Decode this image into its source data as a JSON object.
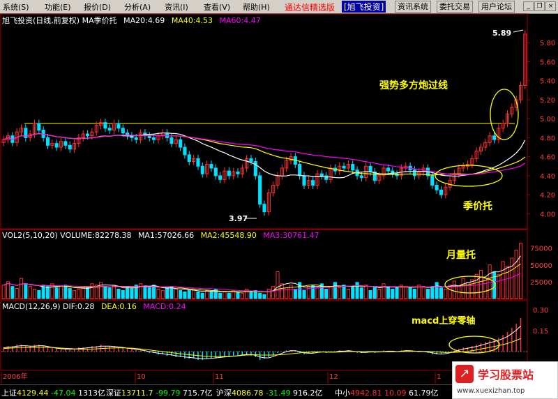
{
  "menu": {
    "items": [
      "系统(S)",
      "功能(E)",
      "报价(D)",
      "分析(A)",
      "资讯(I)",
      "查看(V)",
      "帮助(H)"
    ],
    "brand": "通达信精选版",
    "stock_tag": "[旭飞投资]",
    "buttons": [
      "资讯系统",
      "委托交易",
      "用户论坛"
    ]
  },
  "price_header": {
    "title": "旭飞投资(日线,前复权) MA季价托",
    "ma20": "MA20:4.69",
    "ma40": "MA40:4.53",
    "ma60": "MA60:4.47"
  },
  "vol_header": {
    "title": "VOL2(5,10,20) VOLUME:82278.38",
    "ma1": "MA1:57026.66",
    "ma2": "MA2:45548.90",
    "ma3": "MA3:30761.47"
  },
  "macd_header": {
    "title": "MACD(12,26,9) DIF:0.28",
    "dea": "DEA:0.16",
    "macd": "MACD:0.24"
  },
  "annotations": {
    "strong": "强势多方炮过线",
    "season": "季价托",
    "month": "月量托",
    "macd": "macd上穿零轴",
    "high": "5.89",
    "low": "3.97"
  },
  "axis": {
    "price_ticks": [
      "5.80",
      "5.60",
      "5.40",
      "5.20",
      "5.00",
      "4.80",
      "4.60",
      "4.40",
      "4.20",
      "4.00"
    ],
    "vol_ticks": [
      "75000",
      "50000",
      "25000"
    ],
    "macd_ticks": [
      "0.30",
      "0.15"
    ],
    "date_ticks": [
      "2006年",
      "10",
      "11",
      "12",
      "1"
    ]
  },
  "status": {
    "sh_label": "上证",
    "sh_val": "4129.44",
    "sh_chg": "-47.04",
    "sh_amt": "1313亿",
    "sz_label": "深证",
    "sz_val": "13711.7",
    "sz_chg": "-99.79",
    "sz_amt": "715.7亿",
    "hs_label": "沪深",
    "hs_val": "4086.78",
    "hs_chg": "-31.49",
    "hs_amt": "916.2亿",
    "zx_label": "中小",
    "zx_val": "4942.81",
    "zx_chg": "10.09",
    "zx_amt": "61.79亿"
  },
  "watermark": {
    "name": "学习股票站",
    "url": "www.xuexizhan.top"
  },
  "colors": {
    "up": "#ff3030",
    "down": "#00e0ff",
    "ma20": "#ffffff",
    "ma40": "#ffff00",
    "ma60": "#ff00ff",
    "reference": "#ffff00"
  },
  "chart_data": {
    "type": "candlestick",
    "reference_line": 4.95,
    "ylim": [
      3.9,
      6.0
    ],
    "highest": 5.89,
    "lowest": 3.97,
    "closes": [
      4.78,
      4.82,
      4.75,
      4.86,
      4.9,
      4.8,
      4.84,
      4.95,
      4.88,
      4.8,
      4.72,
      4.74,
      4.7,
      4.76,
      4.72,
      4.68,
      4.74,
      4.8,
      4.84,
      4.82,
      4.86,
      4.93,
      4.96,
      4.9,
      4.88,
      4.95,
      4.9,
      4.85,
      4.82,
      4.8,
      4.78,
      4.85,
      4.82,
      4.8,
      4.78,
      4.82,
      4.85,
      4.8,
      4.74,
      4.78,
      4.7,
      4.62,
      4.55,
      4.58,
      4.5,
      4.42,
      4.52,
      4.48,
      4.4,
      4.36,
      4.45,
      4.4,
      4.44,
      4.42,
      4.48,
      4.58,
      4.55,
      4.4,
      4.1,
      4.02,
      4.22,
      4.3,
      4.4,
      4.48,
      4.56,
      4.6,
      4.52,
      4.4,
      4.3,
      4.35,
      4.3,
      4.42,
      4.4,
      4.36,
      4.48,
      4.45,
      4.5,
      4.48,
      4.52,
      4.46,
      4.4,
      4.38,
      4.5,
      4.44,
      4.35,
      4.4,
      4.48,
      4.45,
      4.42,
      4.4,
      4.48,
      4.5,
      4.46,
      4.4,
      4.44,
      4.48,
      4.4,
      4.3,
      4.25,
      4.2,
      4.28,
      4.35,
      4.42,
      4.48,
      4.5,
      4.52,
      4.58,
      4.66,
      4.7,
      4.75,
      4.82,
      4.78,
      4.9,
      4.95,
      5.05,
      5.12,
      5.2,
      5.35,
      5.89
    ],
    "volume": [
      20000,
      25000,
      18000,
      15000,
      30000,
      22000,
      18000,
      14000,
      12000,
      20000,
      18000,
      22000,
      16000,
      18000,
      20000,
      15000,
      12000,
      14000,
      16000,
      18000,
      22000,
      20000,
      24000,
      18000,
      16000,
      20000,
      14000,
      12000,
      18000,
      16000,
      20000,
      22000,
      18000,
      16000,
      20000,
      14000,
      12000,
      16000,
      18000,
      14000,
      12000,
      10000,
      12000,
      14000,
      10000,
      8000,
      12000,
      10000,
      14000,
      8000,
      10000,
      8000,
      12000,
      10000,
      8000,
      14000,
      10000,
      12000,
      8000,
      6000,
      14000,
      18000,
      40000,
      22000,
      16000,
      20000,
      14000,
      24000,
      12000,
      18000,
      20000,
      16000,
      22000,
      14000,
      18000,
      24000,
      16000,
      20000,
      14000,
      18000,
      24000,
      16000,
      20000,
      12000,
      18000,
      14000,
      22000,
      18000,
      14000,
      16000,
      20000,
      18000,
      16000,
      14000,
      20000,
      18000,
      14000,
      18000,
      24000,
      16000,
      14000,
      20000,
      26000,
      18000,
      30000,
      24000,
      28000,
      36000,
      42000,
      30000,
      50000,
      40000,
      36000,
      55000,
      48000,
      60000,
      72000,
      82278
    ],
    "macd": [
      0.03,
      0.04,
      0.04,
      0.05,
      0.05,
      0.04,
      0.04,
      0.05,
      0.05,
      0.04,
      0.03,
      0.03,
      0.02,
      0.02,
      0.02,
      0.02,
      0.02,
      0.03,
      0.03,
      0.03,
      0.04,
      0.04,
      0.05,
      0.04,
      0.04,
      0.04,
      0.03,
      0.03,
      0.02,
      0.02,
      0.01,
      0.01,
      0.0,
      -0.01,
      -0.01,
      -0.02,
      -0.02,
      -0.03,
      -0.03,
      -0.04,
      -0.04,
      -0.05,
      -0.05,
      -0.05,
      -0.06,
      -0.06,
      -0.05,
      -0.05,
      -0.05,
      -0.04,
      -0.04,
      -0.04,
      -0.03,
      -0.03,
      -0.02,
      -0.02,
      -0.03,
      -0.04,
      -0.06,
      -0.05,
      -0.04,
      -0.03,
      -0.01,
      0.0,
      0.01,
      0.01,
      0.0,
      -0.01,
      -0.02,
      -0.01,
      -0.01,
      0.0,
      0.0,
      -0.01,
      0.0,
      0.0,
      0.01,
      0.0,
      0.01,
      0.0,
      -0.01,
      -0.01,
      0.0,
      0.0,
      -0.01,
      0.0,
      0.01,
      0.0,
      0.0,
      0.0,
      0.01,
      0.01,
      0.0,
      0.0,
      0.0,
      0.0,
      -0.01,
      -0.02,
      -0.02,
      -0.02,
      -0.01,
      0.0,
      0.01,
      0.02,
      0.03,
      0.03,
      0.04,
      0.05,
      0.06,
      0.07,
      0.08,
      0.09,
      0.1,
      0.12,
      0.14,
      0.17,
      0.2,
      0.24
    ]
  }
}
